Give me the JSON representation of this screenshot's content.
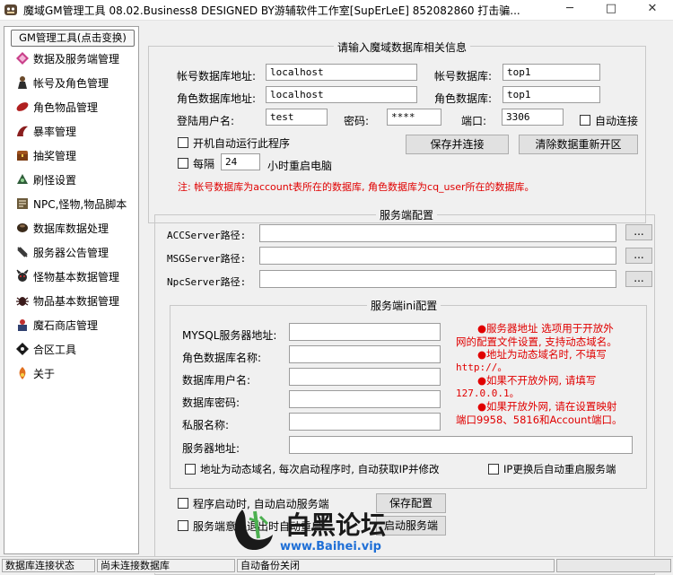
{
  "window": {
    "title": "魔域GM管理工具 08.02.Business8 DESIGNED BY游辅软件工作室[SupErLeE] 852082860 打击骗...",
    "minimize": "─",
    "maximize": "□",
    "close": "✕"
  },
  "sidebar": {
    "header": "GM管理工具(点击变换)",
    "items": [
      {
        "label": "数据及服务端管理",
        "icon": "diamond-icon"
      },
      {
        "label": "帐号及角色管理",
        "icon": "character-icon"
      },
      {
        "label": "角色物品管理",
        "icon": "item-icon"
      },
      {
        "label": "暴率管理",
        "icon": "drop-rate-icon"
      },
      {
        "label": "抽奖管理",
        "icon": "chest-icon"
      },
      {
        "label": "刷怪设置",
        "icon": "monster-spawn-icon"
      },
      {
        "label": "NPC,怪物,物品脚本",
        "icon": "script-icon"
      },
      {
        "label": "数据库数据处理",
        "icon": "database-icon"
      },
      {
        "label": "服务器公告管理",
        "icon": "announce-icon"
      },
      {
        "label": "怪物基本数据管理",
        "icon": "monster-icon"
      },
      {
        "label": "物品基本数据管理",
        "icon": "bug-icon"
      },
      {
        "label": "魔石商店管理",
        "icon": "shop-icon"
      },
      {
        "label": "合区工具",
        "icon": "merge-icon"
      },
      {
        "label": "关于",
        "icon": "about-icon"
      }
    ]
  },
  "db_group": {
    "legend": "请输入魔域数据库相关信息",
    "account_db_host_label": "帐号数据库地址:",
    "account_db_host": "localhost",
    "account_db_label": "帐号数据库:",
    "account_db": "top1",
    "role_db_host_label": "角色数据库地址:",
    "role_db_host": "localhost",
    "role_db_label": "角色数据库:",
    "role_db": "top1",
    "user_label": "登陆用户名:",
    "user": "test",
    "password_label": "密码:",
    "password": "****",
    "port_label": "端口:",
    "port": "3306",
    "auto_connect": "自动连接",
    "autorun": "开机自动运行此程序",
    "every": "每隔",
    "hours": "24",
    "restart_suffix": "小时重启电脑",
    "save_connect": "保存并连接",
    "clear_reopen": "清除数据重新开区",
    "note": "注: 帐号数据库为account表所在的数据库, 角色数据库为cq_user所在的数据库。"
  },
  "server_group": {
    "legend": "服务端配置",
    "acc_label": "ACCServer路径:",
    "msg_label": "MSGServer路径:",
    "npc_label": "NpcServer路径:",
    "browse": "..."
  },
  "ini_group": {
    "legend": "服务端ini配置",
    "mysql_host": "MYSQL服务器地址:",
    "role_db_name": "角色数据库名称:",
    "db_user": "数据库用户名:",
    "db_password": "数据库密码:",
    "server_name": "私服名称:",
    "server_addr": "服务器地址:",
    "info_lines": [
      "●服务器地址 选项用于开放外",
      "网的配置文件设置, 支持动态域名。",
      "●地址为动态域名时, 不填写",
      "http://。",
      "●如果不开放外网, 请填写",
      "127.0.0.1。",
      "●如果开放外网, 请在设置映射",
      "端口9958、5816和Account端口。"
    ],
    "dynamic_domain": "地址为动态域名, 每次启动程序时, 自动获取IP并修改",
    "ip_restart": "IP更换后自动重启服务端",
    "start_with_server": "程序启动时, 自动启动服务端",
    "server_crash": "服务端意外退出时自动重启",
    "save_config": "保存配置",
    "start_server": "启动服务端"
  },
  "statusbar": {
    "db_state_label": "数据库连接状态",
    "db_state": "尚未连接数据库",
    "backup": "自动备份关闭"
  },
  "watermark": {
    "brand": "白黑论坛",
    "url": "www.Baihei.vip"
  }
}
